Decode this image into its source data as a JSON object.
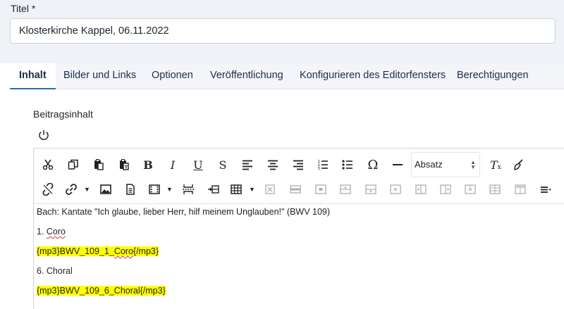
{
  "title_field": {
    "label": "Titel *",
    "value": "Klosterkirche Kappel, 06.11.2022"
  },
  "tabs": [
    {
      "label": "Inhalt",
      "active": true
    },
    {
      "label": "Bilder und Links"
    },
    {
      "label": "Optionen"
    },
    {
      "label": "Veröffentlichung"
    },
    {
      "label": "Konfigurieren des Editorfensters"
    },
    {
      "label": "Berechtigungen"
    }
  ],
  "content_label": "Beitragsinhalt",
  "toolbar": {
    "row1": [
      "cut-icon",
      "copy-icon",
      "paste-icon",
      "paste-text-icon",
      "bold-icon",
      "italic-icon",
      "underline-icon",
      "strikethrough-icon",
      "align-left-icon",
      "align-center-icon",
      "align-right-icon",
      "ordered-list-icon",
      "bullet-list-icon",
      "omega-icon",
      "horizontal-rule-icon",
      "clear-format-icon",
      "clean-icon"
    ],
    "format_select": "Absatz",
    "row2": [
      "unlink-icon",
      "link-icon",
      "image-icon",
      "document-icon",
      "media-icon",
      "page-break-icon",
      "insert-icon",
      "table-icon",
      "table-cell-icons",
      "more-icon"
    ]
  },
  "content": {
    "line1": "Bach: Kantate \"Ich glaube, lieber Herr, hilf meinem Unglauben!\" (BWV 109)",
    "line2_prefix": "1. ",
    "line2_word": "Coro",
    "line3_prefix": "{mp3}BWV_109_1_",
    "line3_word": "Coro",
    "line3_suffix": "{/mp3}",
    "line4": "6. Choral",
    "line5": "{mp3}BWV_109_6_Choral{/mp3}"
  },
  "colors": {
    "accent": "#2a69b8",
    "highlight": "#ffff00",
    "background": "#eff2f6"
  }
}
